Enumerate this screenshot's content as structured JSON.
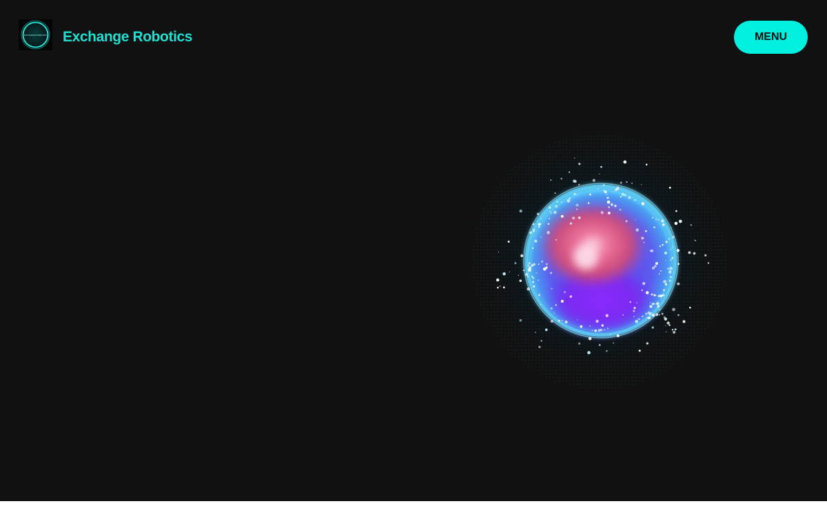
{
  "header": {
    "brand_name": "Exchange Robotics",
    "logo_text": "EXCHANGE ROBOTICS",
    "menu_label": "MENU"
  },
  "hero": {
    "visual": "glowing-particle-orb"
  },
  "colors": {
    "background": "#111111",
    "accent": "#00f0e0",
    "brand_text": "#1fe0d0",
    "orb_pink": "#e8587a",
    "orb_purple": "#8a2cff",
    "orb_rim": "#4fc8ff"
  }
}
